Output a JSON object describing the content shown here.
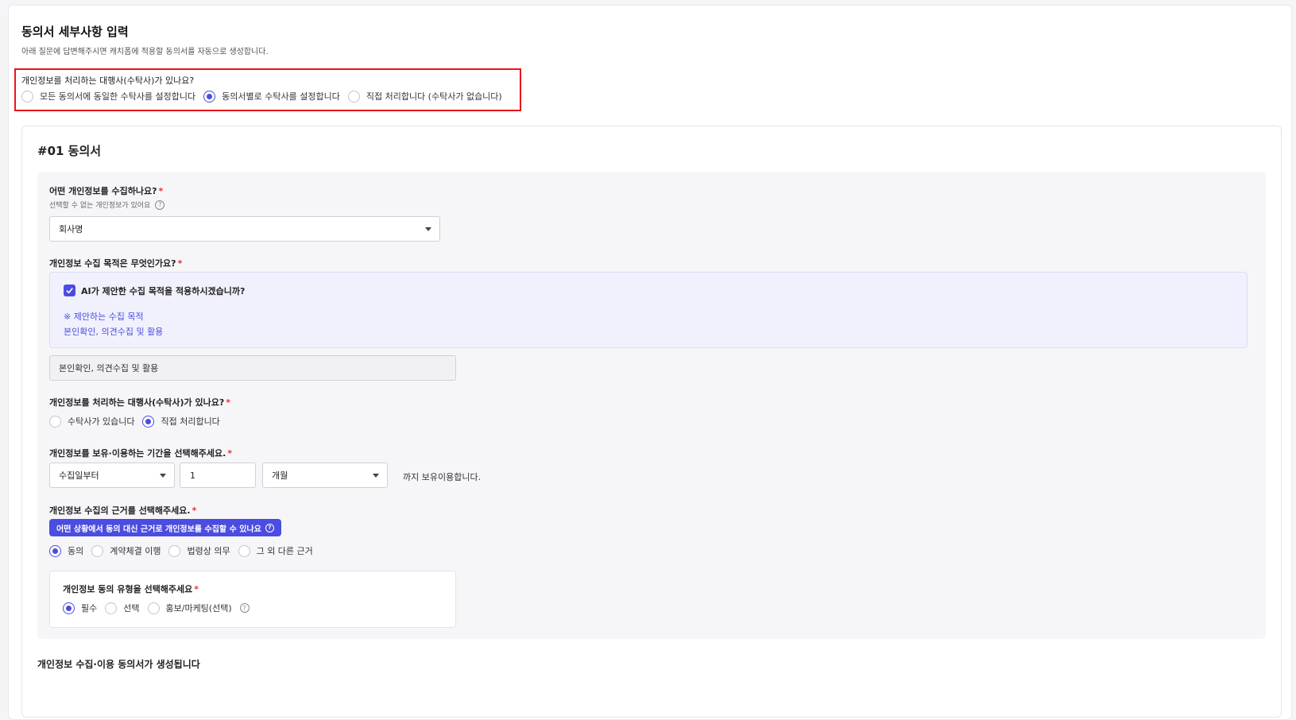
{
  "page": {
    "title": "동의서 세부사항 입력",
    "subtitle": "아래 질문에 답변해주시면 캐치폼에 적용할 동의서를 자동으로 생성합니다."
  },
  "processor_question": {
    "label": "개인정보를 처리하는 대행사(수탁사)가 있나요?",
    "options": [
      {
        "label": "모든 동의서에 동일한 수탁사를 설정합니다",
        "selected": false
      },
      {
        "label": "동의서별로 수탁사를 설정합니다",
        "selected": true
      },
      {
        "label": "직접 처리합니다 (수탁사가 없습니다)",
        "selected": false
      }
    ]
  },
  "consent": {
    "title": "#01 동의서",
    "collect": {
      "label": "어떤 개인정보를 수집하나요?",
      "required_mark": "*",
      "hint": "선택할 수 없는 개인정보가 있어요",
      "help_icon": "?",
      "value": "회사명"
    },
    "purpose": {
      "label": "개인정보 수집 목적은 무엇인가요?",
      "required_mark": "*",
      "ai_checkbox_label": "AI가 제안한 수집 목적을 적용하시겠습니까?",
      "ai_checked": true,
      "ai_suggest_heading": "※ 제안하는 수집 목적",
      "ai_suggest_value": "본인확인, 의견수집 및 활용",
      "value": "본인확인, 의견수집 및 활용"
    },
    "processor": {
      "label": "개인정보를 처리하는 대행사(수탁사)가 있나요?",
      "required_mark": "*",
      "options": [
        {
          "label": "수탁사가 있습니다",
          "selected": false
        },
        {
          "label": "직접 처리합니다",
          "selected": true
        }
      ]
    },
    "retention": {
      "label": "개인정보를 보유·이용하는 기간을 선택해주세요.",
      "required_mark": "*",
      "start_value": "수집일부터",
      "amount_value": "1",
      "unit_value": "개월",
      "suffix": "까지 보유이용합니다."
    },
    "basis": {
      "label": "개인정보 수집의 근거를 선택해주세요.",
      "required_mark": "*",
      "info_button": "어떤 상황에서 동의 대신 근거로 개인정보를 수집할 수 있나요",
      "help_icon": "?",
      "options": [
        {
          "label": "동의",
          "selected": true
        },
        {
          "label": "계약체결 이행",
          "selected": false
        },
        {
          "label": "법령상 의무",
          "selected": false
        },
        {
          "label": "그 외 다른 근거",
          "selected": false
        }
      ]
    },
    "consent_type": {
      "label": "개인정보 동의 유형을 선택해주세요",
      "required_mark": "*",
      "help_icon": "?",
      "options": [
        {
          "label": "필수",
          "selected": true
        },
        {
          "label": "선택",
          "selected": false
        },
        {
          "label": "홍보/마케팅(선택)",
          "selected": false
        }
      ]
    },
    "footer_note": "개인정보 수집·이용 동의서가 생성됩니다"
  },
  "colors": {
    "accent": "#4b4de0",
    "highlight_outline": "#e8141b",
    "required": "#e5323b"
  }
}
